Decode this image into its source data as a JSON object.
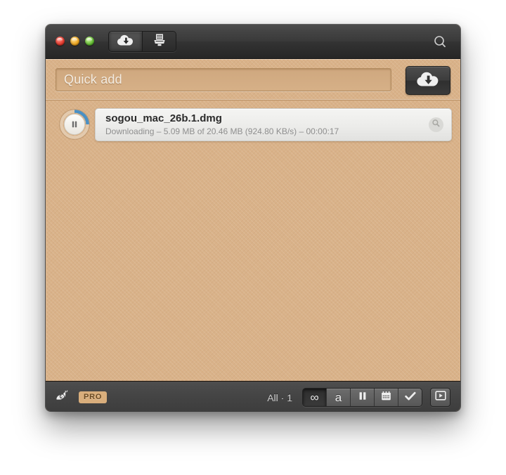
{
  "window": {
    "title": "",
    "traffic_lights": [
      {
        "name": "close",
        "color": "#e23b2e"
      },
      {
        "name": "minimize",
        "color": "#eda621"
      },
      {
        "name": "zoom",
        "color": "#63bb34"
      }
    ],
    "toolbar": {
      "segments": [
        {
          "name": "downloads-tab",
          "icon": "cloud-download-icon",
          "active": true
        },
        {
          "name": "shredder-tab",
          "icon": "shredder-icon",
          "active": false
        }
      ],
      "search_icon": "search-icon"
    }
  },
  "quick_add": {
    "placeholder": "Quick add",
    "value": "",
    "add_button_icon": "cloud-download-icon"
  },
  "downloads": [
    {
      "filename": "sogou_mac_26b.1.dmg",
      "status": "Downloading – 5.09 MB of 20.46 MB (924.80 KB/s) – 00:00:17",
      "state": "downloading",
      "progress_percent": 25,
      "downloaded": "5.09 MB",
      "total": "20.46 MB",
      "speed": "924.80 KB/s",
      "time_remaining": "00:00:17",
      "transfer_control_icon": "pause-icon",
      "reveal_icon": "magnifier-icon",
      "progress_color": "#4a90c4"
    }
  ],
  "status_bar": {
    "speed_limit_icon": "snail-icon",
    "pro_badge": "PRO",
    "pro_badge_color": "#d9ae7c",
    "count_label": "All · 1",
    "filters": [
      {
        "name": "filter-all",
        "icon": "infinity-icon",
        "glyph": "∞",
        "active": true
      },
      {
        "name": "filter-active",
        "icon": "letter-a-icon",
        "glyph": "a",
        "active": false
      },
      {
        "name": "filter-paused",
        "icon": "pause-icon",
        "glyph": "II",
        "active": false
      },
      {
        "name": "filter-scheduled",
        "icon": "calendar-icon",
        "glyph": "",
        "active": false
      },
      {
        "name": "filter-completed",
        "icon": "checkmark-icon",
        "glyph": "✔",
        "active": false
      }
    ],
    "media_button_icon": "play-box-icon"
  }
}
